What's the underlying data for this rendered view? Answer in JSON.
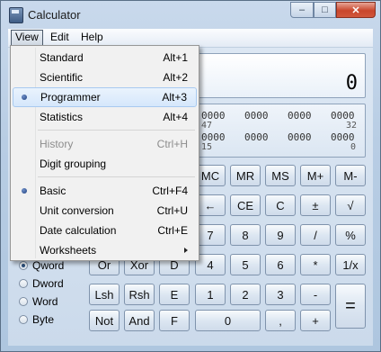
{
  "window": {
    "title": "Calculator",
    "minimize": "–",
    "maximize": "□",
    "close": "✕"
  },
  "menubar": {
    "items": [
      "View",
      "Edit",
      "Help"
    ]
  },
  "display": {
    "value": "0"
  },
  "bits": {
    "row1": [
      "0000",
      "0000",
      "0000",
      "0000",
      "0000"
    ],
    "row1_tail": "47",
    "row1_right": "32",
    "row2": [
      "0000",
      "0000",
      "0000",
      "0000",
      "0000"
    ],
    "row2_tail": "15",
    "row2_right": "0"
  },
  "view_menu": {
    "items": [
      {
        "label": "Standard",
        "accel": "Alt+1"
      },
      {
        "label": "Scientific",
        "accel": "Alt+2"
      },
      {
        "label": "Programmer",
        "accel": "Alt+3"
      },
      {
        "label": "Statistics",
        "accel": "Alt+4"
      },
      {
        "label": "History",
        "accel": "Ctrl+H"
      },
      {
        "label": "Digit grouping",
        "accel": ""
      },
      {
        "label": "Basic",
        "accel": "Ctrl+F4"
      },
      {
        "label": "Unit conversion",
        "accel": "Ctrl+U"
      },
      {
        "label": "Date calculation",
        "accel": "Ctrl+E"
      },
      {
        "label": "Worksheets",
        "accel": ""
      }
    ]
  },
  "keypad": {
    "row1": [
      "MC",
      "MR",
      "MS",
      "M+",
      "M-"
    ],
    "row2": [
      "←",
      "CE",
      "C",
      "±",
      "√"
    ],
    "row3": [
      "7",
      "8",
      "9",
      "/",
      "%"
    ],
    "row4": [
      "4",
      "5",
      "6",
      "*",
      "1/x"
    ],
    "row5": [
      "Lsh",
      "Rsh",
      "E",
      "1",
      "2",
      "3",
      "-"
    ],
    "row6": [
      "Not",
      "And",
      "F",
      "0",
      ",",
      "+"
    ],
    "equals": "=",
    "partial": [
      "Or",
      "Xor",
      "D"
    ]
  },
  "word_size": {
    "options": [
      "Qword",
      "Dword",
      "Word",
      "Byte"
    ],
    "selected": "Qword"
  }
}
